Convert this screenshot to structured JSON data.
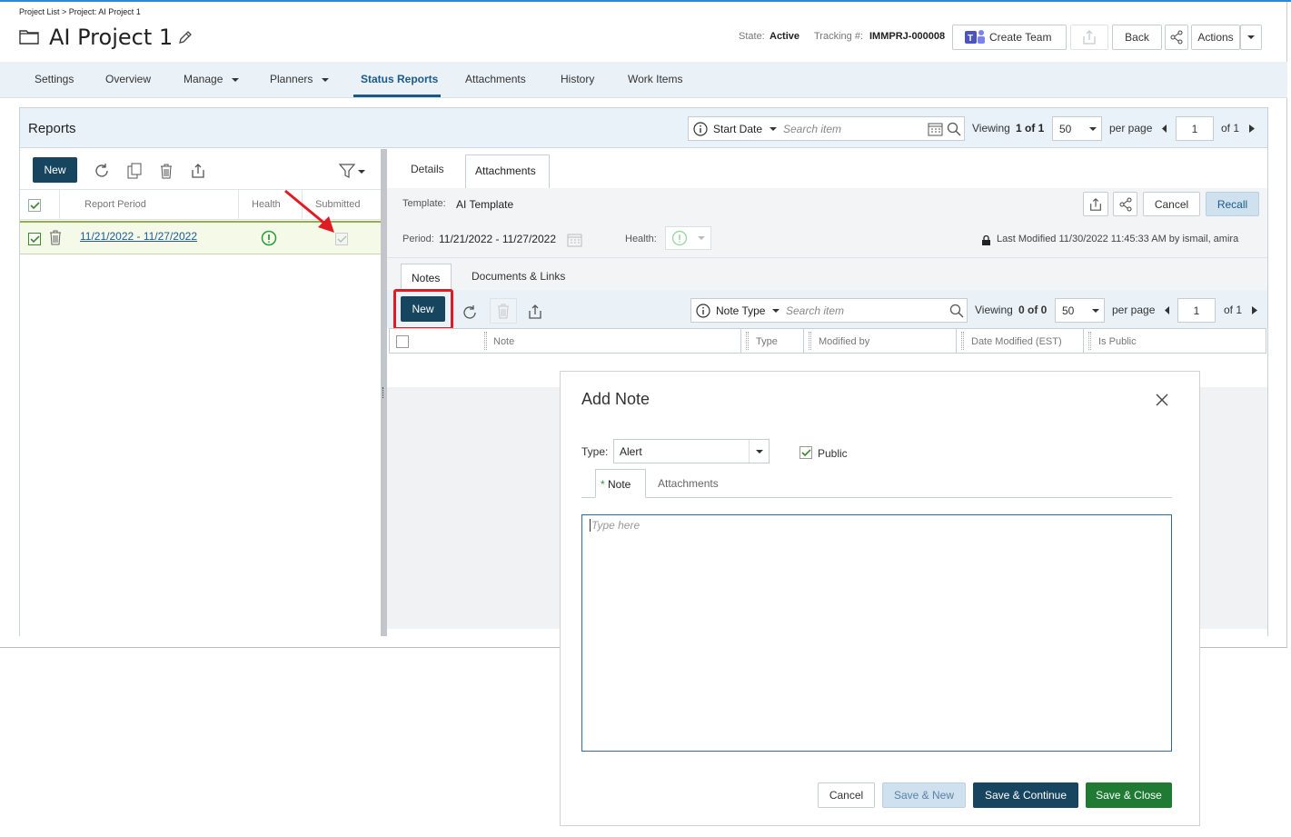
{
  "breadcrumb": "Project List > Project: AI Project 1",
  "project_title": "AI Project 1",
  "state_label": "State:",
  "state_value": "Active",
  "tracking_label": "Tracking #:",
  "tracking_value": "IMMPRJ-000008",
  "header_buttons": {
    "create_team": "Create Team",
    "back": "Back",
    "actions": "Actions"
  },
  "nav": {
    "tabs": [
      "Settings",
      "Overview",
      "Manage",
      "Planners",
      "Status Reports",
      "Attachments",
      "History",
      "Work Items"
    ],
    "active": "Status Reports"
  },
  "reports": {
    "title": "Reports",
    "filter_field": "Start Date",
    "search_placeholder": "Search item",
    "viewing_prefix": "Viewing",
    "viewing_range": "1 of 1",
    "page_size": "50",
    "per_page": "per page",
    "page": "1",
    "of_pages": "of 1"
  },
  "left_panel": {
    "new_label": "New",
    "columns": [
      "Report Period",
      "Health",
      "Submitted"
    ],
    "rows": [
      {
        "period": "11/21/2022 - 11/27/2022"
      }
    ]
  },
  "detail_tabs": [
    "Details",
    "Attachments"
  ],
  "detail": {
    "template_label": "Template:",
    "template_value": "AI Template",
    "cancel_label": "Cancel",
    "recall_label": "Recall",
    "period_label": "Period:",
    "period_value": "11/21/2022 - 11/27/2022",
    "health_label": "Health:",
    "last_modified": "Last Modified 11/30/2022 11:45:33 AM by ismail, amira"
  },
  "notes_tabs": [
    "Notes",
    "Documents & Links"
  ],
  "notes_toolbar": {
    "new_label": "New",
    "filter_field": "Note Type",
    "search_placeholder": "Search item",
    "viewing_prefix": "Viewing",
    "viewing_range": "0 of 0",
    "page_size": "50",
    "per_page": "per page",
    "page": "1",
    "of_pages": "of 1"
  },
  "notes_columns": [
    "Note",
    "Type",
    "Modified by",
    "Date Modified (EST)",
    "Is Public"
  ],
  "modal": {
    "title": "Add Note",
    "type_label": "Type:",
    "type_value": "Alert",
    "public_label": "Public",
    "required_mark": "*",
    "tab_note": "Note",
    "tab_attachments": "Attachments",
    "note_placeholder": "Type here",
    "buttons": {
      "cancel": "Cancel",
      "save_new": "Save & New",
      "save_continue": "Save & Continue",
      "save_close": "Save & Close"
    }
  },
  "colors": {
    "primary_dark": "#17455f",
    "save_close_green": "#1f7a33",
    "health_green": "#2a9a3a",
    "annotation_red": "#e01b24",
    "nav_active": "#1a5a8a"
  }
}
